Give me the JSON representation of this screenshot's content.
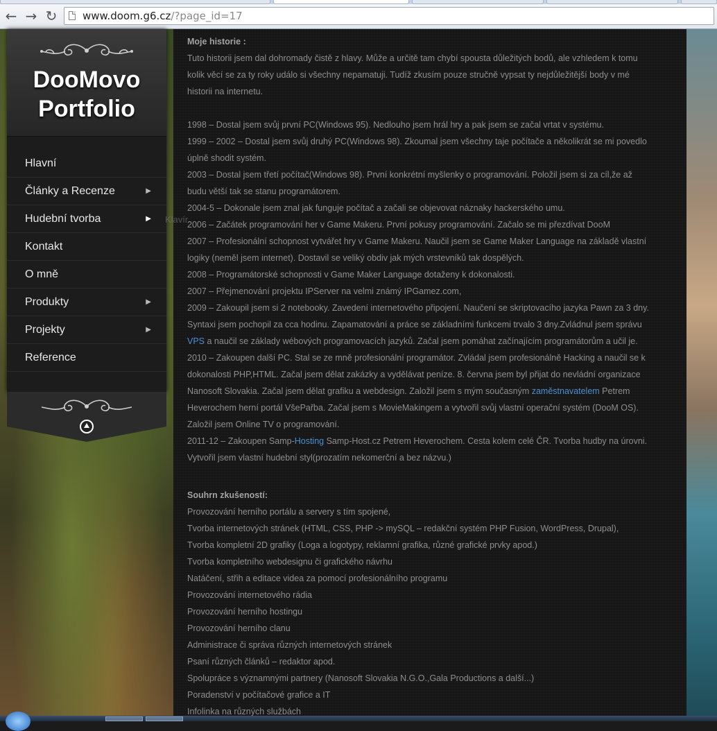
{
  "browser": {
    "url_host": "www.doom.g6.cz",
    "url_path": "/?page_id=17"
  },
  "sidebar": {
    "site_title_line1": "DooMovo",
    "site_title_line2": "Portfolio",
    "menu": [
      {
        "label": "Hlavní",
        "has_submenu": false
      },
      {
        "label": "Články a Recenze",
        "has_submenu": true
      },
      {
        "label": "Hudební tvorba",
        "has_submenu": true
      },
      {
        "label": "Kontakt",
        "has_submenu": false
      },
      {
        "label": "O mně",
        "has_submenu": false
      },
      {
        "label": "Produkty",
        "has_submenu": true
      },
      {
        "label": "Projekty",
        "has_submenu": true
      },
      {
        "label": "Reference",
        "has_submenu": false
      }
    ],
    "flyout_hint": "Klavír"
  },
  "content": {
    "history_title": "Moje historie :",
    "intro": [
      "Tuto historii jsem dal dohromady čistě z hlavy. Může a určitě tam chybí spousta důležitých bodů, ale vzhledem k tomu",
      "kolik věcí se za ty roky událo si všechny nepamatuji. Tudíž zkusím pouze stručně vypsat ty nejdůležitější body v mé",
      "historii na internetu."
    ],
    "timeline": [
      "1998 – Dostal jsem svůj první PC(Windows 95). Nedlouho jsem hrál hry a pak jsem se začal vrtat v systému.",
      "1999 – 2002 – Dostal jsem svůj druhý PC(Windows 98). Zkoumal jsem všechny taje počítače a několikrát se mi povedlo",
      "úplně shodit systém.",
      "2003 – Dostal jsem třetí počítač(Windows 98). První konkrétní myšlenky o programování. Položil jsem si za cíl,že až",
      "budu větší tak se stanu programátorem.",
      "2004-5 – Dokonale jsem znal jak funguje počítač a začali se objevovat náznaky hackerského umu.",
      "2006 – Začátek programování her v Game Makeru. První pokusy programování. Začalo se mi přezdívat DooM",
      "2007 – Profesionální schopnost vytvářet hry v Game Makeru. Naučil jsem se Game Maker Language na základě vlastní",
      "logiky (neměl jsem internet). Dostavil se veliký obdiv jak mých vrstevníků tak dospělých.",
      "2008 – Programátorské schopnosti v Game Maker Language dotaženy k dokonalosti.",
      "2007 – Přejmenování projektu IPServer na velmi známý IPGamez.com,",
      "2009 – Zakoupil jsem si 2 notebooky. Zavedení internetového připojení. Naučení se skriptovacího jazyka Pawn za 3 dny.",
      "Syntaxi jsem pochopil za cca hodinu. Zapamatování a práce se základními funkcemi trvalo 3 dny.Zvládnul jsem správu"
    ],
    "vps_line_link": "VPS",
    "vps_line_rest": " a naučil se základy wébových programovacích jazyků. Začal jsem pomáhat začínajícím programátorům a učil je.",
    "timeline2": [
      "2010 – Zakoupen další PC. Stal se ze mně profesionální programátor. Zvládal jsem profesionálně Hacking a naučil se k",
      "dokonalosti PHP,HTML. Začal jsem dělat zakázky a vydělávat peníze. 8. června jsem byl přijat do nevládní organizace"
    ],
    "employer_pre": "Nanosoft Slovakia. Začal jsem dělat grafiku a webdesign. Založil jsem s mým současným ",
    "employer_link": "zaměstnavatelem",
    "employer_post": " Petrem",
    "timeline3": [
      "Heverochem herní portál VšePařba. Začal jsem s MovieMakingem a vytvořil svůj vlastní operační systém (DooM OS).",
      "Založil jsem Online TV o programování."
    ],
    "hosting_pre": "2011-12 – Zakoupen Samp-",
    "hosting_link": "Hosting",
    "hosting_post": " Samp-Host.cz Petrem Heverochem. Cesta kolem celé ČR. Tvorba hudby na úrovni.",
    "timeline4": [
      "Vytvořil jsem vlastní hudební styl(prozatím nekomerční a bez názvu.)"
    ],
    "summary_title": "Souhrn zkušeností:",
    "summary": [
      "Provozování herního portálu a servery s tím spojené,",
      "Tvorba internetových stránek (HTML, CSS, PHP -> mySQL – redakční systém PHP Fusion, WordPress, Drupal),",
      "Tvorba kompletní 2D grafiky (Loga a logotypy, reklamní grafika, různé grafické prvky apod.)",
      "Tvorba kompletního webdesignu či grafického návrhu",
      "Natáčení, střih a editace videa za pomocí profesionálního programu",
      "Provozování internetového rádia",
      "Provozování herního hostingu",
      "Provozování herního clanu",
      "Administrace či správa různých internetových stránek",
      "Psaní různých článků – redaktor apod.",
      "Spolupráce s významnými partnery (Nanosoft Slovakia N.G.O.,Gala Productions a další...)",
      "Poradenství v počítačové grafice a IT",
      "Infolinka na různých službách"
    ]
  }
}
